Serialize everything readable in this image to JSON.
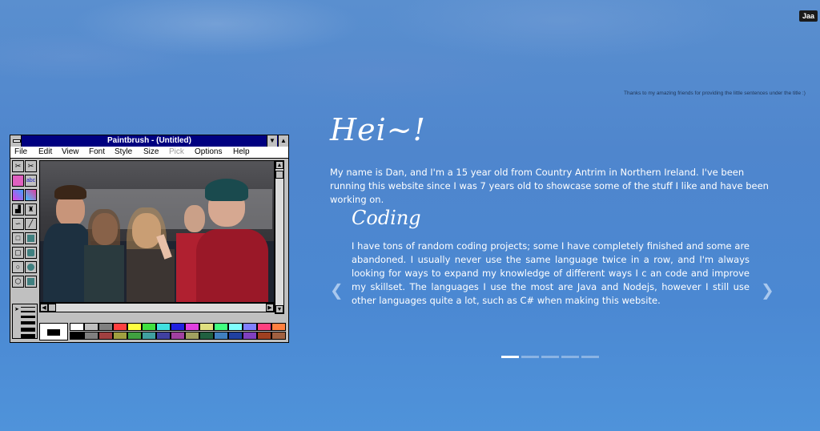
{
  "language_button": "Jaa",
  "thanks_note": "Thanks to my amazing friends for providing the little sentences under the title :)",
  "paintbrush": {
    "title": "Paintbrush - (Untitled)",
    "menu": [
      "File",
      "Edit",
      "View",
      "Font",
      "Style",
      "Size",
      "Pick",
      "Options",
      "Help"
    ],
    "disabled_menu": "Pick",
    "tools": [
      "scissors-star-icon",
      "scissors-icon",
      "airbrush-icon",
      "text-icon",
      "color-eraser-icon",
      "eraser-icon",
      "paint-roller-icon",
      "brush-icon",
      "curve-icon",
      "line-icon",
      "rectangle-icon",
      "filled-rectangle-icon",
      "rounded-rectangle-icon",
      "filled-rounded-rectangle-icon",
      "ellipse-icon",
      "filled-ellipse-icon",
      "polygon-icon",
      "filled-polygon-icon"
    ],
    "tool_text": {
      "text": "abc"
    },
    "palette_top": [
      "#ffffff",
      "#c0c0c0",
      "#808080",
      "#ff4040",
      "#ffff40",
      "#40e040",
      "#40e0e0",
      "#2020e0",
      "#e040e0",
      "#e0e080",
      "#40ff80",
      "#80ffff",
      "#8080ff",
      "#ff4080",
      "#ff8040"
    ],
    "palette_bottom": [
      "#000000",
      "#808080",
      "#a04040",
      "#a0a040",
      "#40a040",
      "#40a0a0",
      "#4040a0",
      "#a040a0",
      "#a0a060",
      "#206040",
      "#4080c0",
      "#2040a0",
      "#8040c0",
      "#a04020",
      "#a06040"
    ]
  },
  "hello": "Hei~!",
  "intro": "My name is Dan, and I'm a 15 year old from Country Antrim in Northern Ireland. I've been running this website since I was 7 years old to showcase some of the stuff I like and have been working on.",
  "slide": {
    "title": "Coding",
    "text": "I have tons of random coding projects; some I have completely finished and some are abandoned. I usually never use the same language twice in a row, and I'm always looking for ways to expand my knowledge of different ways I c an code and improve my skillset. The languages I use the most are Java and Nodejs, however I still use other languages quite a lot, such as C# when making this website."
  },
  "carousel": {
    "count": 5,
    "active": 0,
    "prev_icon": "chevron-left-icon",
    "next_icon": "chevron-right-icon"
  },
  "colors": {
    "background": "#4f86cd",
    "text": "#ffffff",
    "title_bar": "#000080"
  }
}
